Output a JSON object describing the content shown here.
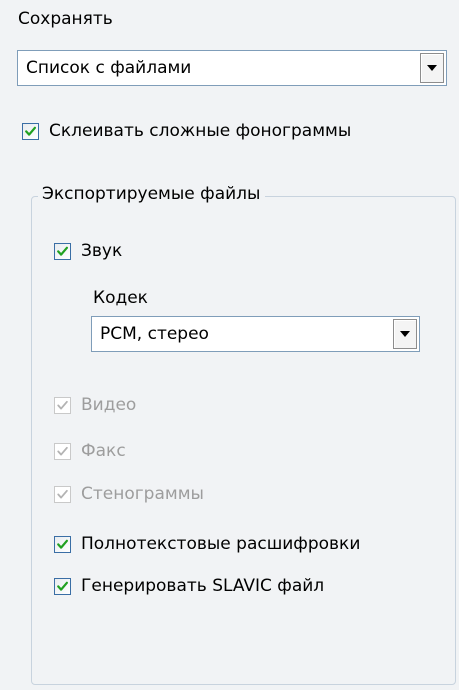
{
  "save": {
    "label": "Сохранять",
    "selected": "Список с файлами"
  },
  "merge_complex": {
    "label": "Склеивать сложные фонограммы",
    "checked": true
  },
  "exported": {
    "title": "Экспортируемые файлы",
    "sound": {
      "label": "Звук",
      "checked": true
    },
    "codec": {
      "label": "Кодек",
      "selected": "PCM, стерео"
    },
    "video": {
      "label": "Видео",
      "checked": true,
      "enabled": false
    },
    "fax": {
      "label": "Факс",
      "checked": true,
      "enabled": false
    },
    "transcripts": {
      "label": "Стенограммы",
      "checked": true,
      "enabled": false
    },
    "fulltext": {
      "label": "Полнотекстовые расшифровки",
      "checked": true
    },
    "slavic": {
      "label": "Генерировать SLAVIC файл",
      "checked": true
    }
  },
  "colors": {
    "background": "#f1f3f5",
    "check_enabled": "#21a121",
    "check_disabled": "#b3b3b3",
    "disabled_text": "#9d9d9d",
    "group_border": "#c8d3de"
  },
  "icons": {
    "dropdown": "chevron-down-icon",
    "check": "check-icon"
  }
}
